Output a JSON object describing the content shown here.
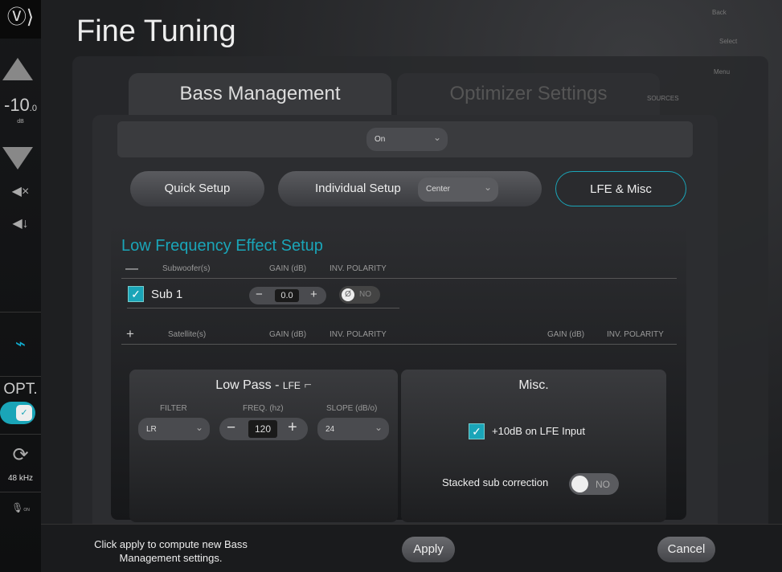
{
  "sidebar": {
    "volume": "-10",
    "volume_decimal": ".0",
    "unit": "dB",
    "input": "OPT.",
    "sample_rate": "48 kHz",
    "mic_label": "ON"
  },
  "title": "Fine Tuning",
  "background": {
    "back": "Back",
    "select": "Select",
    "menu": "Menu",
    "sources": "SOURCES"
  },
  "tabs": [
    {
      "label": "Bass Management",
      "active": true
    },
    {
      "label": "Optimizer Settings",
      "active": false
    }
  ],
  "mode_select": "On",
  "buttons": {
    "quick": "Quick Setup",
    "individual": "Individual Setup",
    "individual_select": "Center",
    "lfe": "LFE & Misc"
  },
  "lfe": {
    "heading": "Low Frequency Effect Setup",
    "sub_cols": [
      "Subwoofer(s)",
      "GAIN (dB)",
      "INV. POLARITY"
    ],
    "sub": {
      "name": "Sub 1",
      "gain": "0.0",
      "polarity": "NO",
      "checked": true
    },
    "sat_cols": [
      "Satellite(s)",
      "GAIN (dB)",
      "INV. POLARITY",
      "GAIN (dB)",
      "INV. POLARITY"
    ]
  },
  "lowpass": {
    "title": "Low Pass - ",
    "title_suffix": "LFE",
    "filter_label": "FILTER",
    "filter": "LR",
    "freq_label": "FREQ. (hz)",
    "freq": "120",
    "slope_label": "SLOPE (dB/o)",
    "slope": "24"
  },
  "misc": {
    "title": "Misc.",
    "boost_label": "+10dB on LFE Input",
    "boost_checked": true,
    "stacked_label": "Stacked sub correction",
    "stacked": "NO"
  },
  "footer": {
    "message": "Click apply to compute new Bass Management settings.",
    "apply": "Apply",
    "cancel": "Cancel"
  },
  "colors": {
    "accent": "#1aa5b8"
  }
}
